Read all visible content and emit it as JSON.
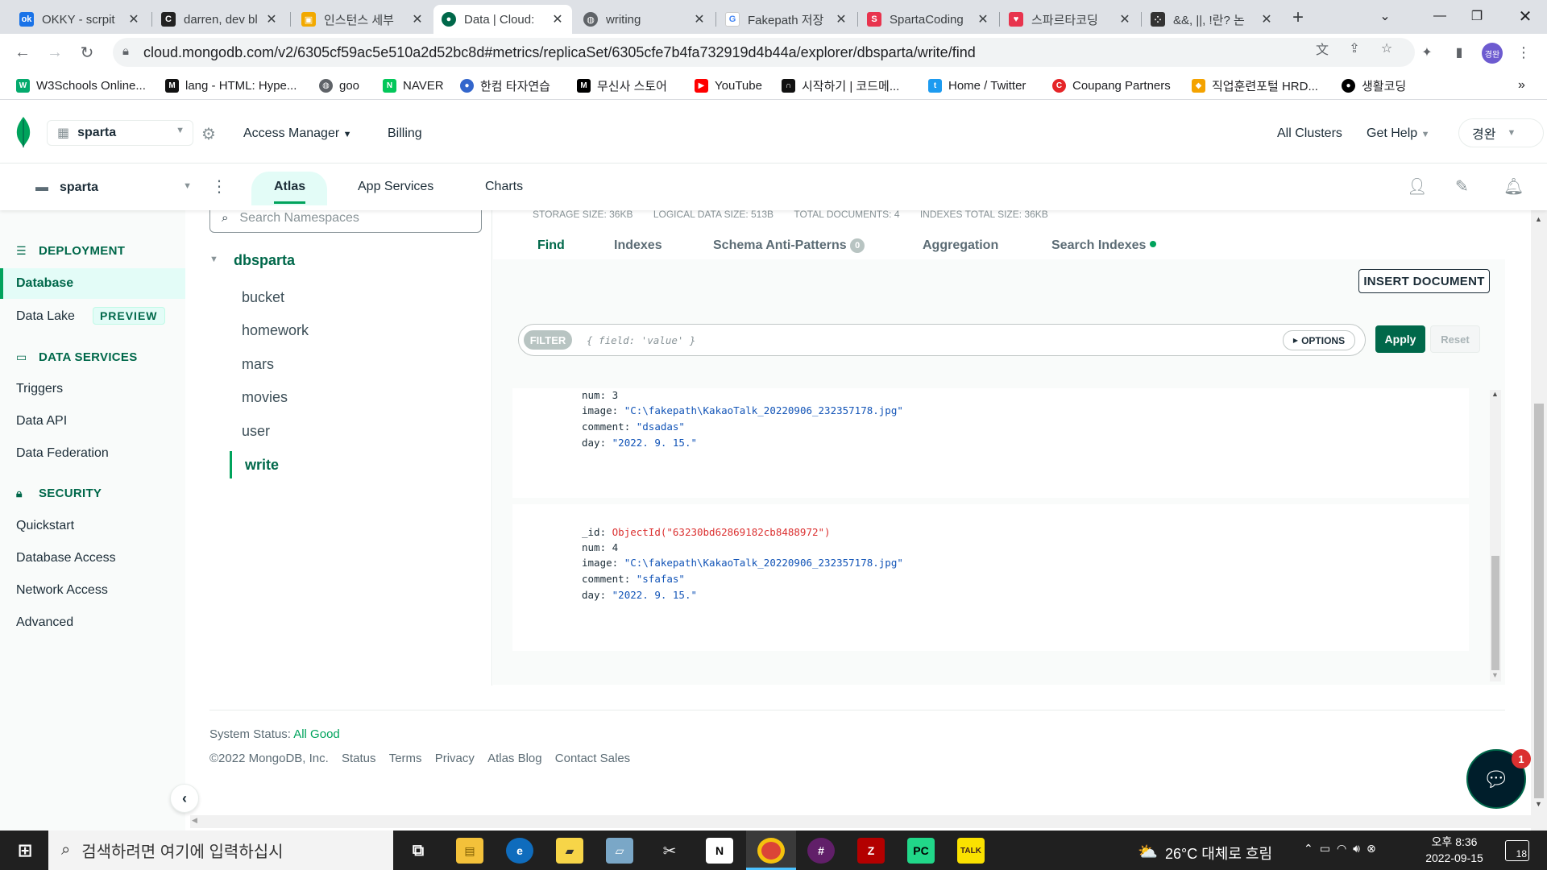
{
  "browser": {
    "tabs": [
      {
        "title": "OKKY - scrpit",
        "fav_color": "#1a73e8",
        "fav": "ok"
      },
      {
        "title": "darren, dev bl",
        "fav_color": "#222222",
        "fav": "C"
      },
      {
        "title": "인스턴스 세부",
        "fav_color": "#f2a900",
        "fav": "▣"
      },
      {
        "title": "Data | Cloud:",
        "fav_color": "#00684a",
        "fav": "●"
      },
      {
        "title": "writing",
        "fav_color": "#5f6368",
        "fav": "◍"
      },
      {
        "title": "Fakepath 저장",
        "fav_color": "#ffffff",
        "fav": "G"
      },
      {
        "title": "SpartaCoding",
        "fav_color": "#e8344e",
        "fav": "S"
      },
      {
        "title": "스파르타코딩",
        "fav_color": "#e8344e",
        "fav": "♥"
      },
      {
        "title": "&&, ||, !란? 논",
        "fav_color": "#333333",
        "fav": "⁘"
      }
    ],
    "url": "cloud.mongodb.com/v2/6305cf59ac5e510a2d52bc8d#metrics/replicaSet/6305cfe7b4fa732919d4b44a/explorer/dbsparta/write/find",
    "profile": "경완",
    "bookmarks": [
      {
        "label": "W3Schools Online...",
        "icon_color": "#04aa6d",
        "icon": "W"
      },
      {
        "label": "lang - HTML: Hype...",
        "icon_color": "#111111",
        "icon": "M"
      },
      {
        "label": "goo",
        "icon_color": "#5f6368",
        "icon": "◍"
      },
      {
        "label": "NAVER",
        "icon_color": "#03c75a",
        "icon": "N"
      },
      {
        "label": "한컴 타자연습",
        "icon_color": "#3366cc",
        "icon": "●"
      },
      {
        "label": "무신사 스토어",
        "icon_color": "#000000",
        "icon": "M"
      },
      {
        "label": "YouTube",
        "icon_color": "#ff0000",
        "icon": "▶"
      },
      {
        "label": "시작하기 | 코드메...",
        "icon_color": "#111111",
        "icon": "∩"
      },
      {
        "label": "Home / Twitter",
        "icon_color": "#1d9bf0",
        "icon": "t"
      },
      {
        "label": "Coupang Partners",
        "icon_color": "#e52528",
        "icon": "C"
      },
      {
        "label": "직업훈련포털 HRD...",
        "icon_color": "#f4a300",
        "icon": "◆"
      },
      {
        "label": "생활코딩",
        "icon_color": "#000000",
        "icon": "●"
      }
    ]
  },
  "atlas": {
    "org": "sparta",
    "access_manager": "Access Manager",
    "billing": "Billing",
    "all_clusters": "All Clusters",
    "get_help": "Get Help",
    "user": "경완",
    "project": "sparta",
    "tabs": [
      "Atlas",
      "App Services",
      "Charts"
    ]
  },
  "sidebar": {
    "deployment": "DEPLOYMENT",
    "database": "Database",
    "data_lake": "Data Lake",
    "preview": "PREVIEW",
    "data_services": "DATA SERVICES",
    "triggers": "Triggers",
    "data_api": "Data API",
    "data_federation": "Data Federation",
    "security": "SECURITY",
    "quickstart": "Quickstart",
    "database_access": "Database Access",
    "network_access": "Network Access",
    "advanced": "Advanced"
  },
  "namespaces": {
    "search_placeholder": "Search Namespaces",
    "db": "dbsparta",
    "collections": [
      "bucket",
      "homework",
      "mars",
      "movies",
      "user",
      "write"
    ]
  },
  "collection": {
    "stats": {
      "storage": "STORAGE SIZE: 36KB",
      "logical": "LOGICAL DATA SIZE: 513B",
      "total_docs": "TOTAL DOCUMENTS: 4",
      "indexes": "INDEXES TOTAL SIZE: 36KB"
    },
    "tabs": {
      "find": "Find",
      "indexes": "Indexes",
      "schema": "Schema Anti-Patterns",
      "schema_count": "0",
      "aggregation": "Aggregation",
      "search": "Search Indexes"
    },
    "insert": "INSERT DOCUMENT",
    "filter_label": "FILTER",
    "filter_placeholder": "{ field: 'value' }",
    "options": "OPTIONS",
    "apply": "Apply",
    "reset": "Reset",
    "documents": [
      {
        "num_k": "num",
        "num": "3",
        "image_k": "image",
        "image": "\"C:\\fakepath\\KakaoTalk_20220906_232357178.jpg\"",
        "comment_k": "comment",
        "comment": "\"dsadas\"",
        "day_k": "day",
        "day": "\"2022. 9. 15.\""
      },
      {
        "id_k": "_id",
        "id": "ObjectId(\"63230bd62869182cb8488972\")",
        "num_k": "num",
        "num": "4",
        "image_k": "image",
        "image": "\"C:\\fakepath\\KakaoTalk_20220906_232357178.jpg\"",
        "comment_k": "comment",
        "comment": "\"sfafas\"",
        "day_k": "day",
        "day": "\"2022. 9. 15.\""
      }
    ]
  },
  "footer": {
    "status_label": "System Status:",
    "status": "All Good",
    "copyright": "©2022 MongoDB, Inc.",
    "links": [
      "Status",
      "Terms",
      "Privacy",
      "Atlas Blog",
      "Contact Sales"
    ]
  },
  "chat_badge": "1",
  "taskbar": {
    "search_placeholder": "검색하려면 여기에 입력하십시",
    "weather": "26°C 대체로 흐림",
    "time": "오후 8:36",
    "date": "2022-09-15",
    "notifications": "18"
  }
}
